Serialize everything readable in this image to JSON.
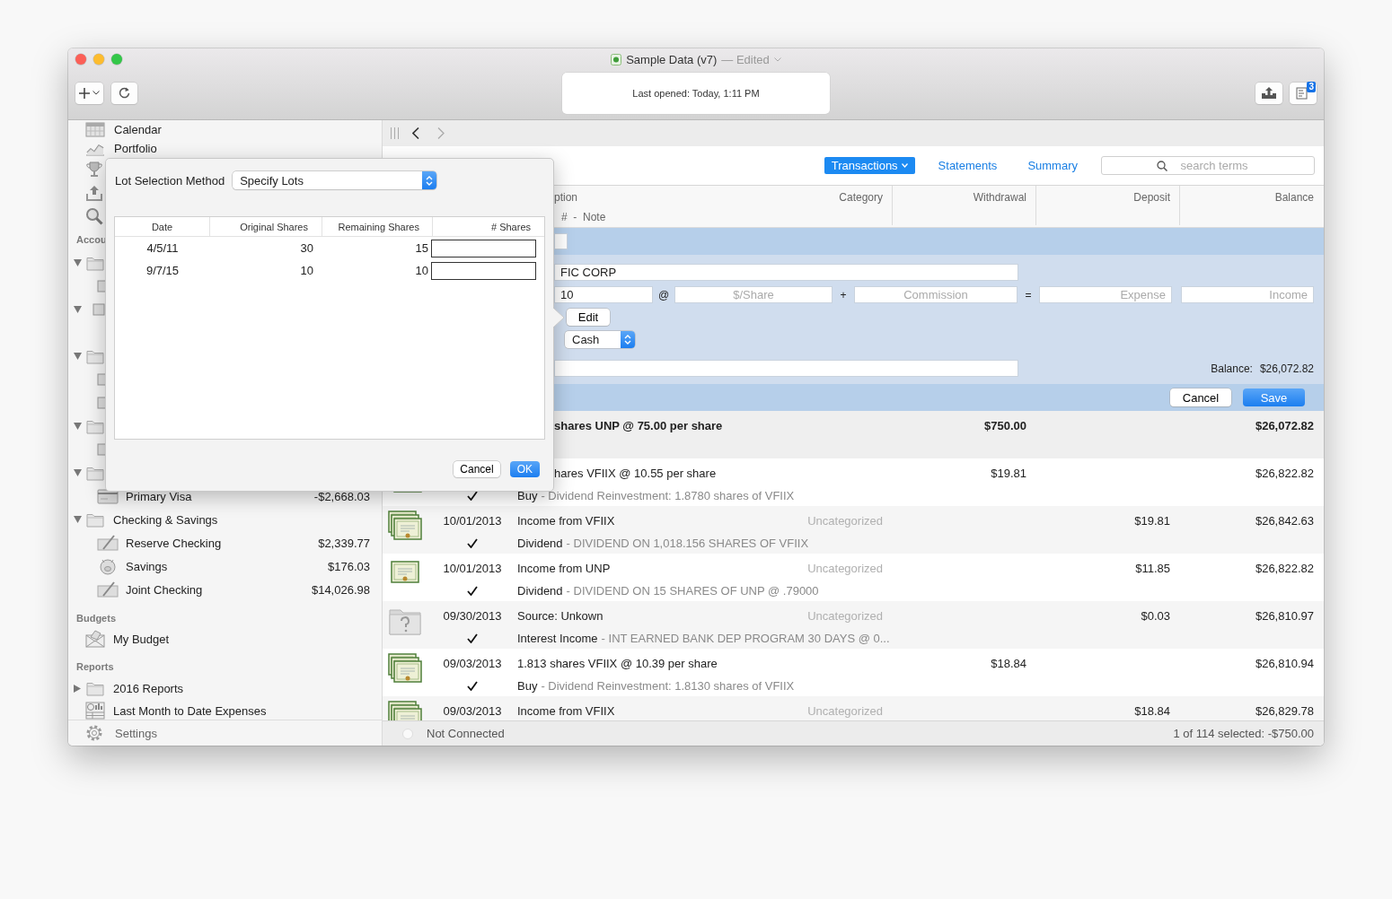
{
  "window": {
    "title": "Sample Data (v7)",
    "subtitle": "— Edited"
  },
  "toolbar": {
    "status": "Last opened: Today, 1:11 PM",
    "badge": "3"
  },
  "sidebar": {
    "items": [
      {
        "kind": "calendar",
        "label": "Calendar"
      },
      {
        "kind": "portfolio",
        "label": "Portfolio"
      },
      {
        "kind": "covered_section",
        "label": "Accou"
      },
      {
        "kind": "credit",
        "label": "Primary Visa",
        "amount": "-$2,668.03"
      },
      {
        "kind": "group",
        "label": "Checking & Savings",
        "expanded": true,
        "children": [
          {
            "kind": "checking",
            "label": "Reserve Checking",
            "amount": "$2,339.77"
          },
          {
            "kind": "savings",
            "label": "Savings",
            "amount": "$176.03"
          },
          {
            "kind": "checking",
            "label": "Joint Checking",
            "amount": "$14,026.98"
          }
        ]
      },
      {
        "kind": "section",
        "label": "Budgets"
      },
      {
        "kind": "budget",
        "label": "My Budget"
      },
      {
        "kind": "section",
        "label": "Reports"
      },
      {
        "kind": "group",
        "label": "2016 Reports",
        "expanded": false
      },
      {
        "kind": "report",
        "label": "Last Month to Date Expenses"
      }
    ],
    "footer": "Settings"
  },
  "tabs": [
    {
      "label": "Transactions",
      "selected": true,
      "menu": true
    },
    {
      "label": "Statements",
      "selected": false,
      "menu": false
    },
    {
      "label": "Summary",
      "selected": false,
      "menu": false
    }
  ],
  "search": {
    "placeholder": "search terms"
  },
  "columns": [
    {
      "label": "ption",
      "sublabel": "#  -  Note"
    },
    {
      "label": "Category"
    },
    {
      "label": "Withdrawal"
    },
    {
      "label": "Deposit"
    },
    {
      "label": "Balance"
    }
  ],
  "editor": {
    "payee": "FIC CORP",
    "shares": "10",
    "price_placeholder": "$/Share",
    "commission_placeholder": "Commission",
    "expense_placeholder": "Expense",
    "income_placeholder": "Income",
    "operators": [
      "@",
      "+",
      "="
    ],
    "edit_button": "Edit",
    "account": "Cash",
    "balance_label": "Balance:",
    "balance": "$26,072.82",
    "cancel_button": "Cancel",
    "save_button": "Save"
  },
  "transactions": [
    {
      "description": "shares UNP @ 75.00 per share",
      "withdrawal": "$750.00",
      "balance": "$26,072.82",
      "selected": true
    },
    {
      "kind": "stack",
      "description": "hares VFIIX @ 10.55 per share",
      "cleared": true,
      "type": "Buy",
      "memo": "- Dividend Reinvestment: 1.8780 shares of VFIIX",
      "withdrawal": "$19.81",
      "balance": "$26,822.82",
      "selected": false
    },
    {
      "kind": "stack",
      "date": "10/01/2013",
      "description": "Income from VFIIX",
      "category": "Uncategorized",
      "cleared": true,
      "type": "Dividend",
      "memo": "- DIVIDEND ON 1,018.156 SHARES OF VFIIX",
      "deposit": "$19.81",
      "balance": "$26,842.63",
      "selected": false
    },
    {
      "kind": "certificate",
      "date": "10/01/2013",
      "description": "Income from UNP",
      "category": "Uncategorized",
      "cleared": true,
      "type": "Dividend",
      "memo": "- DIVIDEND ON 15 SHARES OF UNP @ .79000",
      "deposit": "$11.85",
      "balance": "$26,822.82",
      "selected": false
    },
    {
      "kind": "unknown",
      "date": "09/30/2013",
      "description": "Source: Unkown",
      "category": "Uncategorized",
      "cleared": true,
      "type": "Interest Income",
      "memo": "- INT EARNED BANK DEP PROGRAM 30 DAYS @ 0...",
      "deposit": "$0.03",
      "balance": "$26,810.97",
      "selected": false
    },
    {
      "kind": "stack",
      "date": "09/03/2013",
      "description": "1.813 shares VFIIX @ 10.39 per share",
      "cleared": true,
      "type": "Buy",
      "memo": "- Dividend Reinvestment: 1.8130 shares of VFIIX",
      "withdrawal": "$18.84",
      "balance": "$26,810.94",
      "selected": false
    },
    {
      "kind": "stack",
      "date": "09/03/2013",
      "description": "Income from VFIIX",
      "category": "Uncategorized",
      "deposit": "$18.84",
      "balance": "$26,829.78",
      "selected": false
    }
  ],
  "status_bar": {
    "connection": "Not Connected",
    "selection": "1 of 114 selected: -$750.00"
  },
  "lot_dialog": {
    "label": "Lot Selection Method",
    "method": "Specify Lots",
    "columns": [
      "Date",
      "Original Shares",
      "Remaining Shares",
      "# Shares"
    ],
    "lots": [
      {
        "date": "4/5/11",
        "original": "30",
        "remaining": "15"
      },
      {
        "date": "9/7/15",
        "original": "10",
        "remaining": "10"
      }
    ],
    "cancel_button": "Cancel",
    "ok_button": "OK"
  }
}
